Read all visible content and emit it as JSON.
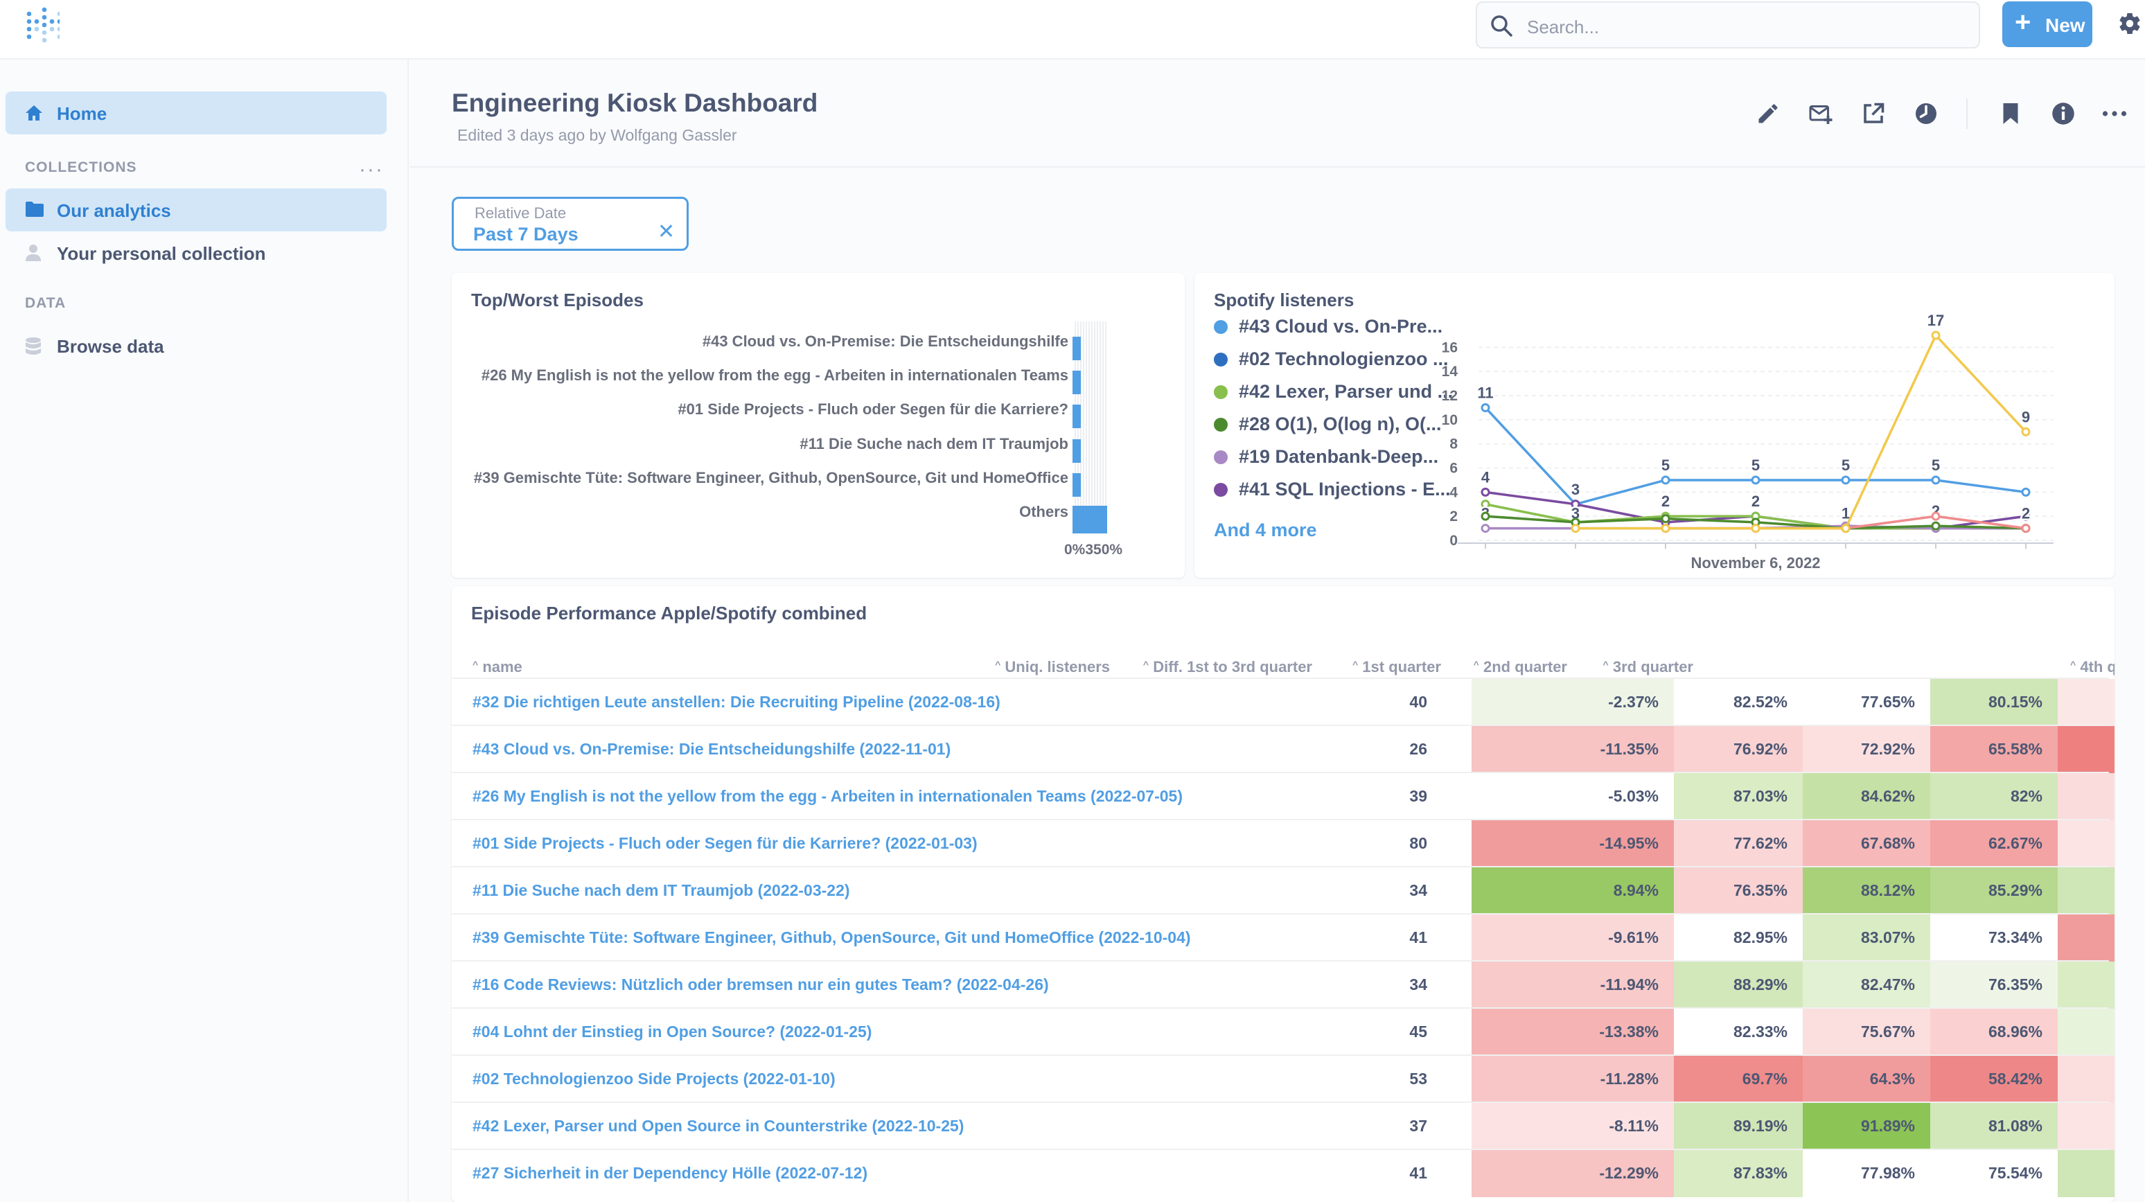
{
  "topbar": {
    "search_placeholder": "Search...",
    "new_label": "New"
  },
  "sidebar": {
    "home_label": "Home",
    "collections_header": "COLLECTIONS",
    "collections": [
      {
        "label": "Our analytics"
      },
      {
        "label": "Your personal collection"
      }
    ],
    "data_header": "DATA",
    "browse_label": "Browse data"
  },
  "dashboard": {
    "title": "Engineering Kiosk Dashboard",
    "subtitle": "Edited 3 days ago by Wolfgang Gassler"
  },
  "filter": {
    "label": "Relative Date",
    "value": "Past 7 Days"
  },
  "cards": {
    "top_worst": {
      "title": "Top/Worst Episodes",
      "axis_label": "0%350%",
      "rows": [
        "#43 Cloud vs. On-Premise: Die Entscheidungshilfe",
        "#26 My English is not the yellow from the egg - Arbeiten in internationalen Teams",
        "#01 Side Projects - Fluch oder Segen für die Karriere?",
        "#11 Die Suche nach dem IT Traumjob",
        "#39 Gemischte Tüte: Software Engineer, Github, OpenSource, Git und HomeOffice",
        "Others"
      ]
    },
    "spotify": {
      "title": "Spotify listeners",
      "legend": [
        {
          "label": "#43 Cloud vs. On-Pre...",
          "color": "#509ee3"
        },
        {
          "label": "#02 Technologienzoo ...",
          "color": "#2f6fc0"
        },
        {
          "label": "#42 Lexer, Parser und ...",
          "color": "#88bf4d"
        },
        {
          "label": "#28 O(1), O(log n), O(...",
          "color": "#4c8a2e"
        },
        {
          "label": "#19 Datenbank-Deep...",
          "color": "#a989c5"
        },
        {
          "label": "#41 SQL Injections - E...",
          "color": "#7a4ba0"
        }
      ],
      "more_label": "And 4 more"
    }
  },
  "chart_data": {
    "type": "line",
    "title": "Spotify listeners",
    "xlabel": "November 6, 2022",
    "ylabel": "",
    "ylim": [
      0,
      17
    ],
    "y_ticks": [
      "0",
      "2",
      "4",
      "6",
      "8",
      "10",
      "12",
      "14",
      "16"
    ],
    "x": [
      0,
      1,
      2,
      3,
      4,
      5,
      6
    ],
    "series": [
      {
        "name": "#43 Cloud vs. On-Pre...",
        "color": "#509ee3",
        "values": [
          11,
          3,
          5,
          5,
          5,
          5,
          4
        ],
        "labels": [
          "11",
          "",
          "5",
          "5",
          "5",
          "5",
          ""
        ]
      },
      {
        "name": "#41 SQL Injections - E...",
        "color": "#7a4ba0",
        "values": [
          4,
          3,
          1.5,
          2,
          1,
          1,
          2
        ],
        "labels": [
          "4",
          "3",
          "",
          "",
          "",
          "",
          ""
        ]
      },
      {
        "name": "#42 Lexer, Parser und ...",
        "color": "#88bf4d",
        "values": [
          3,
          1.5,
          2,
          2,
          1,
          1,
          1
        ],
        "labels": [
          "",
          "",
          "2",
          "2",
          "",
          "",
          "2"
        ]
      },
      {
        "name": "#19 Datenbank-Deep...",
        "color": "#a989c5",
        "values": [
          1,
          1,
          1,
          1,
          1.2,
          1,
          1
        ],
        "labels": [
          "3",
          "3",
          "",
          "",
          "",
          "",
          ""
        ]
      },
      {
        "name": "#28 O(1), O(log n), O(...",
        "color": "#4c8a2e",
        "values": [
          2,
          1.5,
          1.8,
          1.5,
          1,
          1.2,
          1
        ],
        "labels": [
          "",
          "",
          "",
          "",
          "1",
          "2",
          ""
        ]
      },
      {
        "name": "And 4 more (pink)",
        "color": "#ef8c8c",
        "values": [
          null,
          null,
          1,
          1,
          1,
          2,
          1
        ],
        "labels": [
          "",
          "",
          "",
          "",
          "",
          "",
          ""
        ]
      },
      {
        "name": "And 4 more (yellow)",
        "color": "#f2c94c",
        "values": [
          null,
          1,
          1,
          1,
          1,
          17,
          9
        ],
        "labels": [
          "",
          "",
          "",
          "",
          "",
          "17",
          "9"
        ]
      }
    ]
  },
  "table": {
    "title": "Episode Performance Apple/Spotify combined",
    "columns": [
      "name",
      "Uniq. listeners",
      "Diff. 1st to 3rd quarter",
      "1st quarter",
      "2nd quarter",
      "3rd quarter",
      "4th q"
    ],
    "rows": [
      {
        "name": "#32 Die richtigen Leute anstellen: Die Recruiting Pipeline (2022-08-16)",
        "listeners": "40",
        "diff": "-2.37%",
        "q1": "82.52%",
        "q2": "77.65%",
        "q3": "80.15%",
        "c_diff": "#eef5e6",
        "c_q1": "#ffffff",
        "c_q2": "#ffffff",
        "c_q3": "#cfe6b6",
        "c_q4": "#fce7e7"
      },
      {
        "name": "#43 Cloud vs. On-Premise: Die Entscheidungshilfe (2022-11-01)",
        "listeners": "26",
        "diff": "-11.35%",
        "q1": "76.92%",
        "q2": "72.92%",
        "q3": "65.58%",
        "c_diff": "#f7c3c3",
        "c_q1": "#fad2d2",
        "c_q2": "#fce0e0",
        "c_q3": "#f4a7a7",
        "c_q4": "#ee8080"
      },
      {
        "name": "#26 My English is not the yellow from the egg - Arbeiten in internationalen Teams (2022-07-05)",
        "listeners": "39",
        "diff": "-5.03%",
        "q1": "87.03%",
        "q2": "84.62%",
        "q3": "82%",
        "c_diff": "#ffffff",
        "c_q1": "#d9ecc3",
        "c_q2": "#c6e1a5",
        "c_q3": "#d2e8bb",
        "c_q4": "#fbdcdc"
      },
      {
        "name": "#01 Side Projects - Fluch oder Segen für die Karriere? (2022-01-03)",
        "listeners": "80",
        "diff": "-14.95%",
        "q1": "77.62%",
        "q2": "67.68%",
        "q3": "62.67%",
        "c_diff": "#f19c9c",
        "c_q1": "#fbd6d6",
        "c_q2": "#f6b8b8",
        "c_q3": "#f3a3a3",
        "c_q4": "#fce4e4"
      },
      {
        "name": "#11 Die Suche nach dem IT Traumjob (2022-03-22)",
        "listeners": "34",
        "diff": "8.94%",
        "q1": "76.35%",
        "q2": "88.12%",
        "q3": "85.29%",
        "c_diff": "#98c964",
        "c_q1": "#fad2d2",
        "c_q2": "#a8d17a",
        "c_q3": "#b6d98f",
        "c_q4": "#cfe6b6"
      },
      {
        "name": "#39 Gemischte Tüte: Software Engineer, Github, OpenSource, Git und HomeOffice (2022-10-04)",
        "listeners": "41",
        "diff": "-9.61%",
        "q1": "82.95%",
        "q2": "83.07%",
        "q3": "73.34%",
        "c_diff": "#fbd8d8",
        "c_q1": "#ffffff",
        "c_q2": "#d9ecc3",
        "c_q3": "#ffffff",
        "c_q4": "#f19c9c"
      },
      {
        "name": "#16 Code Reviews: Nützlich oder bremsen nur ein gutes Team? (2022-04-26)",
        "listeners": "34",
        "diff": "-11.94%",
        "q1": "88.29%",
        "q2": "82.47%",
        "q3": "76.35%",
        "c_diff": "#f8caca",
        "c_q1": "#d2e8bb",
        "c_q2": "#e2f0d3",
        "c_q3": "#eef5e6",
        "c_q4": "#d9ecc3"
      },
      {
        "name": "#04 Lohnt der Einstieg in Open Source? (2022-01-25)",
        "listeners": "45",
        "diff": "-13.38%",
        "q1": "82.33%",
        "q2": "75.67%",
        "q3": "68.96%",
        "c_diff": "#f5b3b3",
        "c_q1": "#ffffff",
        "c_q2": "#fbdede",
        "c_q3": "#fad0d0",
        "c_q4": "#e8f3dc"
      },
      {
        "name": "#02 Technologienzoo Side Projects (2022-01-10)",
        "listeners": "53",
        "diff": "-11.28%",
        "q1": "69.7%",
        "q2": "64.3%",
        "q3": "58.42%",
        "c_diff": "#f8c6c6",
        "c_q1": "#ef8c8c",
        "c_q2": "#f19c9c",
        "c_q3": "#ee8888",
        "c_q4": "#fbdede"
      },
      {
        "name": "#42 Lexer, Parser und Open Source in Counterstrike (2022-10-25)",
        "listeners": "37",
        "diff": "-8.11%",
        "q1": "89.19%",
        "q2": "91.89%",
        "q3": "81.08%",
        "c_diff": "#fce2e2",
        "c_q1": "#cfe6b6",
        "c_q2": "#8cc456",
        "c_q3": "#d2e8bb",
        "c_q4": "#fce4e4"
      },
      {
        "name": "#27 Sicherheit in der Dependency Hölle (2022-07-12)",
        "listeners": "41",
        "diff": "-12.29%",
        "q1": "87.83%",
        "q2": "77.98%",
        "q3": "75.54%",
        "c_diff": "#f7c3c3",
        "c_q1": "#d9ecc3",
        "c_q2": "#ffffff",
        "c_q3": "#ffffff",
        "c_q4": "#cfe6b6"
      }
    ]
  },
  "colors": {
    "brand": "#509ee3",
    "sidebar_active": "#d2e6f8",
    "text": "#4c5773",
    "muted": "#949aab"
  }
}
